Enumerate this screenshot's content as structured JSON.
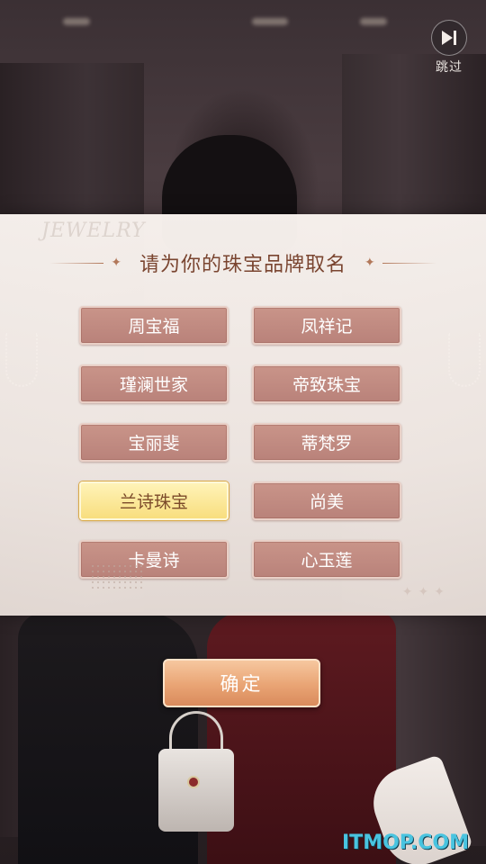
{
  "skip": {
    "label": "跳过",
    "icon": "skip-forward-icon"
  },
  "panel": {
    "watermark": "JEWELRY",
    "title": "请为你的珠宝品牌取名"
  },
  "names": [
    {
      "label": "周宝福",
      "selected": false
    },
    {
      "label": "凤祥记",
      "selected": false
    },
    {
      "label": "瑾澜世家",
      "selected": false
    },
    {
      "label": "帝致珠宝",
      "selected": false
    },
    {
      "label": "宝丽斐",
      "selected": false
    },
    {
      "label": "蒂梵罗",
      "selected": false
    },
    {
      "label": "兰诗珠宝",
      "selected": true
    },
    {
      "label": "尚美",
      "selected": false
    },
    {
      "label": "卡曼诗",
      "selected": false
    },
    {
      "label": "心玉莲",
      "selected": false
    }
  ],
  "confirm": {
    "label": "确定"
  },
  "site_watermark": "ITMOP.COM",
  "colors": {
    "button_default": "#c08b82",
    "button_selected": "#f8de7e",
    "title_color": "#7a4530",
    "confirm": "#e9a474"
  }
}
